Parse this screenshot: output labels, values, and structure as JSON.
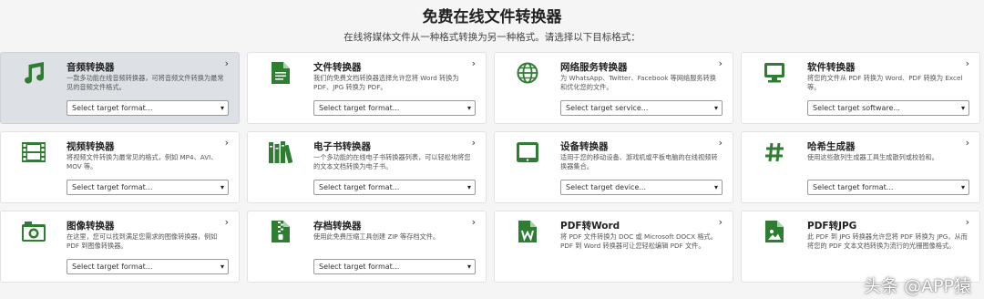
{
  "header": {
    "title": "免费在线文件转换器",
    "subtitle": "在线将媒体文件从一种格式转换为另一种格式。请选择以下目标格式："
  },
  "colors": {
    "accent": "#2e7d32",
    "active_card": "#dde1e6"
  },
  "cards": [
    {
      "name": "音频转换器",
      "desc": "一款多功能在线音频转换器，可将音频文件转换为最常见的音频文件格式。",
      "select": "Select target format...",
      "icon": "music-note-icon",
      "active": true
    },
    {
      "name": "文件转换器",
      "desc": "我们的免费文档转换器选择允许您将 Word 转换为 PDF、JPG 转换为 PDF。",
      "select": "Select target format...",
      "icon": "document-icon"
    },
    {
      "name": "网络服务转换器",
      "desc": "为 WhatsApp、Twitter、Facebook 等网络服务转换和优化您的文件。",
      "select": "Select target service...",
      "icon": "globe-icon"
    },
    {
      "name": "软件转换器",
      "desc": "将您的文件从 PDF 转换为 Word、PDF 转换为 Excel 等。",
      "select": "Select target software...",
      "icon": "monitor-icon"
    },
    {
      "name": "视频转换器",
      "desc": "将视频文件转换为最常见的格式，例如 MP4、AVI、MOV 等。",
      "select": "Select target format...",
      "icon": "film-icon"
    },
    {
      "name": "电子书转换器",
      "desc": "一个多功能的在线电子书转换器列表，可以轻松地将您的文本文档转换为电子书。",
      "select": "Select target format...",
      "icon": "books-icon"
    },
    {
      "name": "设备转换器",
      "desc": "适用于您的移动设备、游戏机或平板电脑的在线视频转换器集合。",
      "select": "Select target device...",
      "icon": "tablet-icon"
    },
    {
      "name": "哈希生成器",
      "desc": "使用这些散列生成器工具生成散列或校验和。",
      "select": "Select target format...",
      "icon": "hash-icon"
    },
    {
      "name": "图像转换器",
      "desc": "在这里，您可以找到满足您需求的图像转换器，例如 PDF 到图像转换器。",
      "select": "Select target format...",
      "icon": "camera-icon"
    },
    {
      "name": "存档转换器",
      "desc": "使用此免费压缩工具创建 ZIP 等存档文件。",
      "select": "Select target format...",
      "icon": "zip-file-icon"
    },
    {
      "name": "PDF转Word",
      "desc": "将 PDF 文件转换为 DOC 或 Microsoft DOCX 格式。PDF 到 Word 转换器可让您轻松编辑 PDF 文件。",
      "select": "",
      "icon": "word-file-icon"
    },
    {
      "name": "PDF转JPG",
      "desc": "此 PDF 到 JPG 转换器允许您将 PDF 转换为 JPG，从而将您的 PDF 文本文档转换为流行的光栅图像格式。",
      "select": "",
      "icon": "image-file-icon"
    }
  ],
  "watermark": "头条 @APP猿"
}
